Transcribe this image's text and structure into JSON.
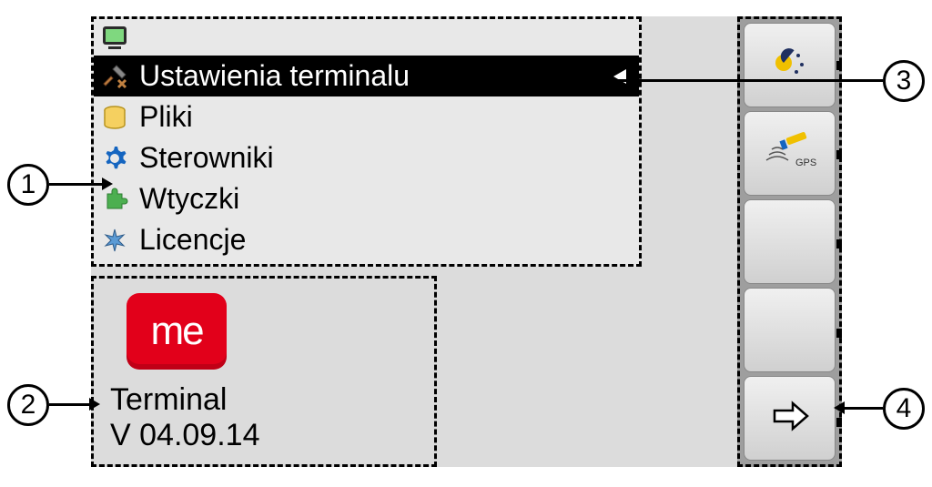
{
  "menu": {
    "items": [
      {
        "label": "Ustawienia terminalu",
        "icon": "tools-icon",
        "selected": true
      },
      {
        "label": "Pliki",
        "icon": "database-icon",
        "selected": false
      },
      {
        "label": "Sterowniki",
        "icon": "gear-icon",
        "selected": false
      },
      {
        "label": "Wtyczki",
        "icon": "puzzle-icon",
        "selected": false
      },
      {
        "label": "Licencje",
        "icon": "license-icon",
        "selected": false
      }
    ]
  },
  "info": {
    "logo_text": "me",
    "name": "Terminal",
    "version": "V 04.09.14"
  },
  "softkeys": [
    {
      "icon": "brightness-icon"
    },
    {
      "icon": "gps-icon",
      "sub": "GPS"
    },
    {
      "icon": ""
    },
    {
      "icon": ""
    },
    {
      "icon": "arrow-right-icon"
    }
  ],
  "callouts": {
    "c1": "1",
    "c2": "2",
    "c3": "3",
    "c4": "4"
  }
}
